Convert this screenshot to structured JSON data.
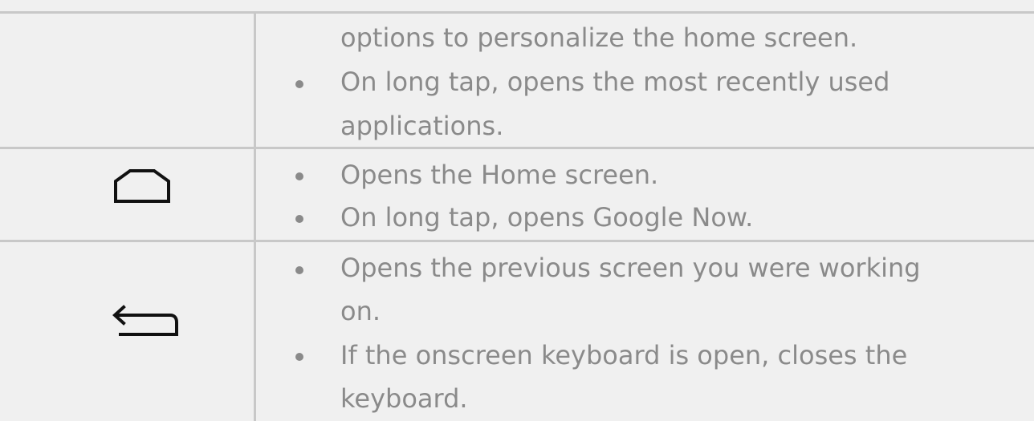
{
  "rows": [
    {
      "icon": "",
      "continuation": "options to personalize the home screen.",
      "items": [
        {
          "lines": [
            "On long tap, opens the most recently used",
            "applications."
          ]
        }
      ]
    },
    {
      "icon": "home-icon",
      "items": [
        {
          "lines": [
            "Opens the Home screen."
          ]
        },
        {
          "lines": [
            "On long tap, opens Google Now."
          ]
        }
      ]
    },
    {
      "icon": "back-icon",
      "items": [
        {
          "lines": [
            "Opens the previous screen you were working",
            "on."
          ]
        },
        {
          "lines": [
            "If the onscreen keyboard is open, closes the",
            "keyboard."
          ]
        }
      ]
    }
  ]
}
